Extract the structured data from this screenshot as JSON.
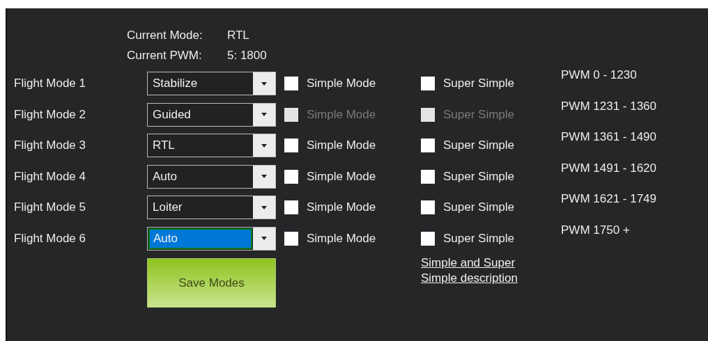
{
  "current_mode": {
    "label": "Current Mode:",
    "value": "RTL"
  },
  "current_pwm": {
    "label": "Current PWM:",
    "value": "5: 1800"
  },
  "flight_modes": [
    {
      "label": "Flight Mode 1",
      "mode": "Stabilize",
      "focused": false,
      "simple": {
        "label": "Simple Mode",
        "checked": false,
        "disabled": false
      },
      "super_simple": {
        "label": "Super Simple",
        "checked": false,
        "disabled": false
      },
      "pwm_range": "PWM 0 - 1230"
    },
    {
      "label": "Flight Mode 2",
      "mode": "Guided",
      "focused": false,
      "simple": {
        "label": "Simple Mode",
        "checked": false,
        "disabled": true
      },
      "super_simple": {
        "label": "Super Simple",
        "checked": false,
        "disabled": true
      },
      "pwm_range": "PWM 1231 - 1360"
    },
    {
      "label": "Flight Mode 3",
      "mode": "RTL",
      "focused": false,
      "simple": {
        "label": "Simple Mode",
        "checked": false,
        "disabled": false
      },
      "super_simple": {
        "label": "Super Simple",
        "checked": false,
        "disabled": false
      },
      "pwm_range": "PWM 1361 - 1490"
    },
    {
      "label": "Flight Mode 4",
      "mode": "Auto",
      "focused": false,
      "simple": {
        "label": "Simple Mode",
        "checked": false,
        "disabled": false
      },
      "super_simple": {
        "label": "Super Simple",
        "checked": false,
        "disabled": false
      },
      "pwm_range": "PWM 1491 - 1620"
    },
    {
      "label": "Flight Mode 5",
      "mode": "Loiter",
      "focused": false,
      "simple": {
        "label": "Simple Mode",
        "checked": false,
        "disabled": false
      },
      "super_simple": {
        "label": "Super Simple",
        "checked": false,
        "disabled": false
      },
      "pwm_range": "PWM 1621 - 1749"
    },
    {
      "label": "Flight Mode 6",
      "mode": "Auto",
      "focused": true,
      "simple": {
        "label": "Simple Mode",
        "checked": false,
        "disabled": false
      },
      "super_simple": {
        "label": "Super Simple",
        "checked": false,
        "disabled": false
      },
      "pwm_range": "PWM 1750 +"
    }
  ],
  "save_button": "Save Modes",
  "description_link": "Simple and Super Simple description"
}
